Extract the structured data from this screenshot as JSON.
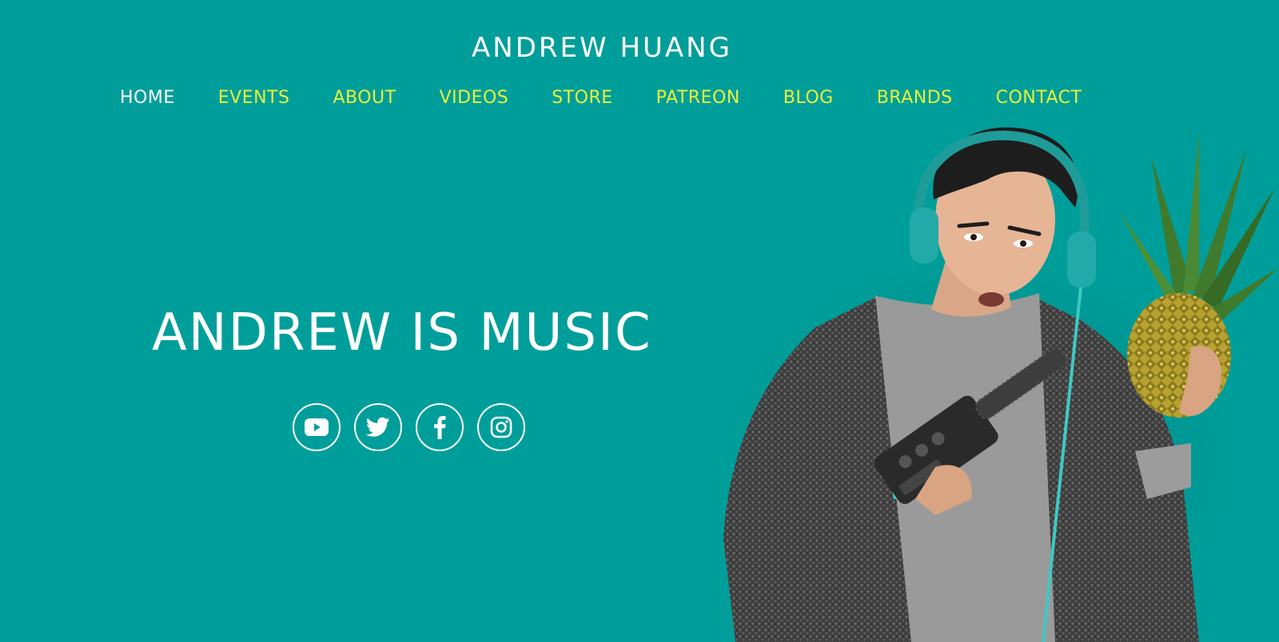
{
  "header": {
    "site_title": "ANDREW HUANG"
  },
  "nav": {
    "items": [
      {
        "label": "HOME",
        "active": true
      },
      {
        "label": "EVENTS"
      },
      {
        "label": "ABOUT"
      },
      {
        "label": "VIDEOS"
      },
      {
        "label": "STORE"
      },
      {
        "label": "PATREON"
      },
      {
        "label": "BLOG"
      },
      {
        "label": "BRANDS"
      },
      {
        "label": "CONTACT"
      }
    ]
  },
  "hero": {
    "heading": "ANDREW IS MUSIC",
    "social_icons": [
      "youtube-icon",
      "twitter-icon",
      "facebook-icon",
      "instagram-icon"
    ]
  },
  "colors": {
    "background": "#009e9a",
    "nav_link": "#e8f23a",
    "nav_active": "#ffffff",
    "text": "#ffffff"
  }
}
